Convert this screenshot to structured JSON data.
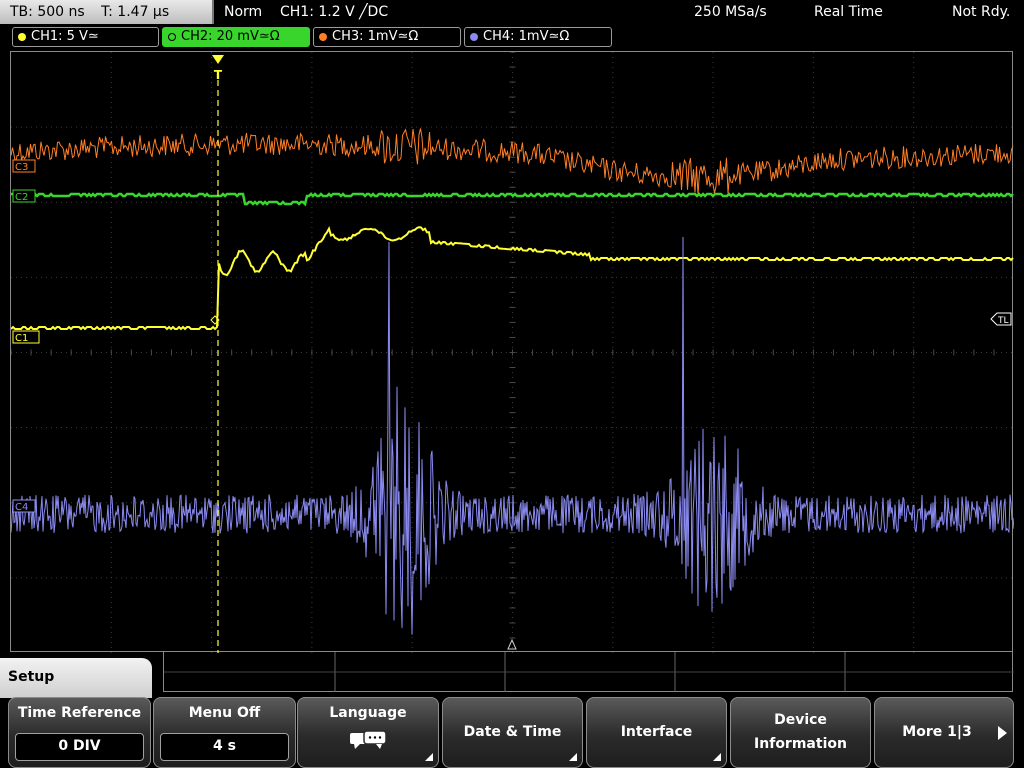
{
  "topbar": {
    "tb": "TB: 500 ns",
    "t": "T: 1.47 µs",
    "mode": "Norm",
    "trigger": "CH1: 1.2 V ╱DC",
    "rate": "250 MSa/s",
    "acq": "Real Time",
    "status": "Not Rdy."
  },
  "channels": [
    {
      "label": "CH1: 5 V≃",
      "color": "#ffff33"
    },
    {
      "label": "CH2: 20 mV≃Ω",
      "color": "#39d42c"
    },
    {
      "label": "CH3: 1mV≃Ω",
      "color": "#ff7f27"
    },
    {
      "label": "CH4: 1mV≃Ω",
      "color": "#8a8af0"
    }
  ],
  "markers": {
    "c1": "C1",
    "c2": "C2",
    "c3": "C3",
    "c4": "C4",
    "tl": "TL",
    "trig": "T"
  },
  "setup_tab": "Setup",
  "softkeys": [
    {
      "label": "Time Reference",
      "value": "0 DIV"
    },
    {
      "label": "Menu Off",
      "value": "4 s"
    },
    {
      "label": "Language",
      "icon": "speech-bubbles-icon"
    },
    {
      "label": "Date & Time"
    },
    {
      "label": "Interface"
    },
    {
      "label_line1": "Device",
      "label_line2": "Information"
    },
    {
      "label": "More 1|3"
    }
  ]
}
